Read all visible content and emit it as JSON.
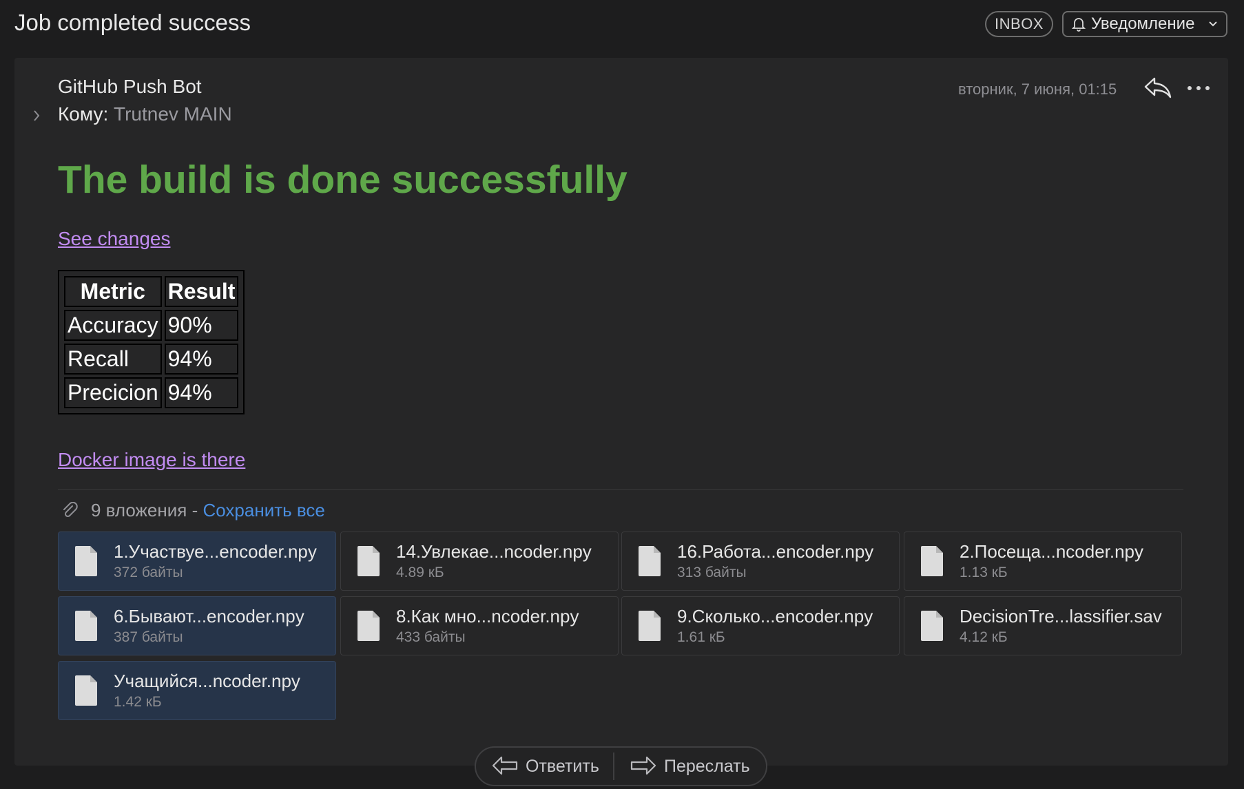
{
  "header": {
    "subject": "Job completed success",
    "folder_badge": "INBOX",
    "notify_label": "Уведомление"
  },
  "message": {
    "sender": "GitHub Push Bot",
    "to_label": "Кому:",
    "recipient": "Trutnev MAIN",
    "date": "вторник, 7 июня, 01:15",
    "headline": "The build is done successfully",
    "changes_link": "See changes",
    "docker_link": "Docker image is there",
    "headline_color": "#5fa84a",
    "link_color": "#c28cf2"
  },
  "metrics_table": {
    "headers": [
      "Metric",
      "Result"
    ],
    "rows": [
      [
        "Accuracy",
        "90%"
      ],
      [
        "Recall",
        "94%"
      ],
      [
        "Precicion",
        "94%"
      ]
    ]
  },
  "attachments": {
    "count_label": "9 вложения -",
    "save_all": "Сохранить все",
    "items": [
      {
        "name": "1.Участвуе...encoder.npy",
        "size": "372 байты",
        "selected": true
      },
      {
        "name": "14.Увлекае...ncoder.npy",
        "size": "4.89 кБ",
        "selected": false
      },
      {
        "name": "16.Работа...encoder.npy",
        "size": "313 байты",
        "selected": false
      },
      {
        "name": "2.Посеща...ncoder.npy",
        "size": "1.13 кБ",
        "selected": false
      },
      {
        "name": "6.Бывают...encoder.npy",
        "size": "387 байты",
        "selected": true
      },
      {
        "name": "8.Как мно...ncoder.npy",
        "size": "433 байты",
        "selected": false
      },
      {
        "name": "9.Сколько...encoder.npy",
        "size": "1.61 кБ",
        "selected": false
      },
      {
        "name": "DecisionTre...lassifier.sav",
        "size": "4.12 кБ",
        "selected": false
      },
      {
        "name": "Учащийся...ncoder.npy",
        "size": "1.42 кБ",
        "selected": true
      }
    ]
  },
  "actions": {
    "reply": "Ответить",
    "forward": "Переслать"
  }
}
